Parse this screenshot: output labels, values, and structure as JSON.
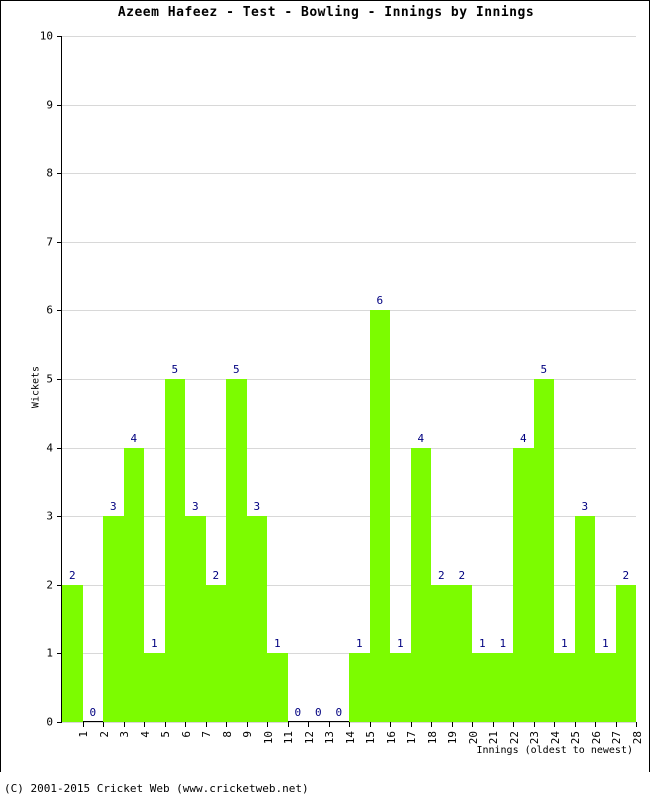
{
  "chart_data": {
    "type": "bar",
    "title": "Azeem Hafeez - Test - Bowling - Innings by Innings",
    "xlabel": "Innings (oldest to newest)",
    "ylabel": "Wickets",
    "categories": [
      "1",
      "2",
      "3",
      "4",
      "5",
      "6",
      "7",
      "8",
      "9",
      "10",
      "11",
      "12",
      "13",
      "14",
      "15",
      "16",
      "17",
      "18",
      "19",
      "20",
      "21",
      "22",
      "23",
      "24",
      "25",
      "26",
      "27",
      "28"
    ],
    "values": [
      2,
      0,
      3,
      4,
      1,
      5,
      3,
      2,
      5,
      3,
      1,
      0,
      0,
      0,
      1,
      6,
      1,
      4,
      2,
      2,
      1,
      1,
      4,
      5,
      1,
      3,
      1,
      2
    ],
    "ylim": [
      0,
      10
    ],
    "yticks": [
      0,
      1,
      2,
      3,
      4,
      5,
      6,
      7,
      8,
      9,
      10
    ],
    "grid": true,
    "legend": false,
    "bar_color": "#7CFC00",
    "value_label_color": "#000080",
    "grid_color": "#D8D8D8",
    "axis_color": "#000000"
  },
  "footer": {
    "copyright": "(C) 2001-2015 Cricket Web (www.cricketweb.net)"
  }
}
